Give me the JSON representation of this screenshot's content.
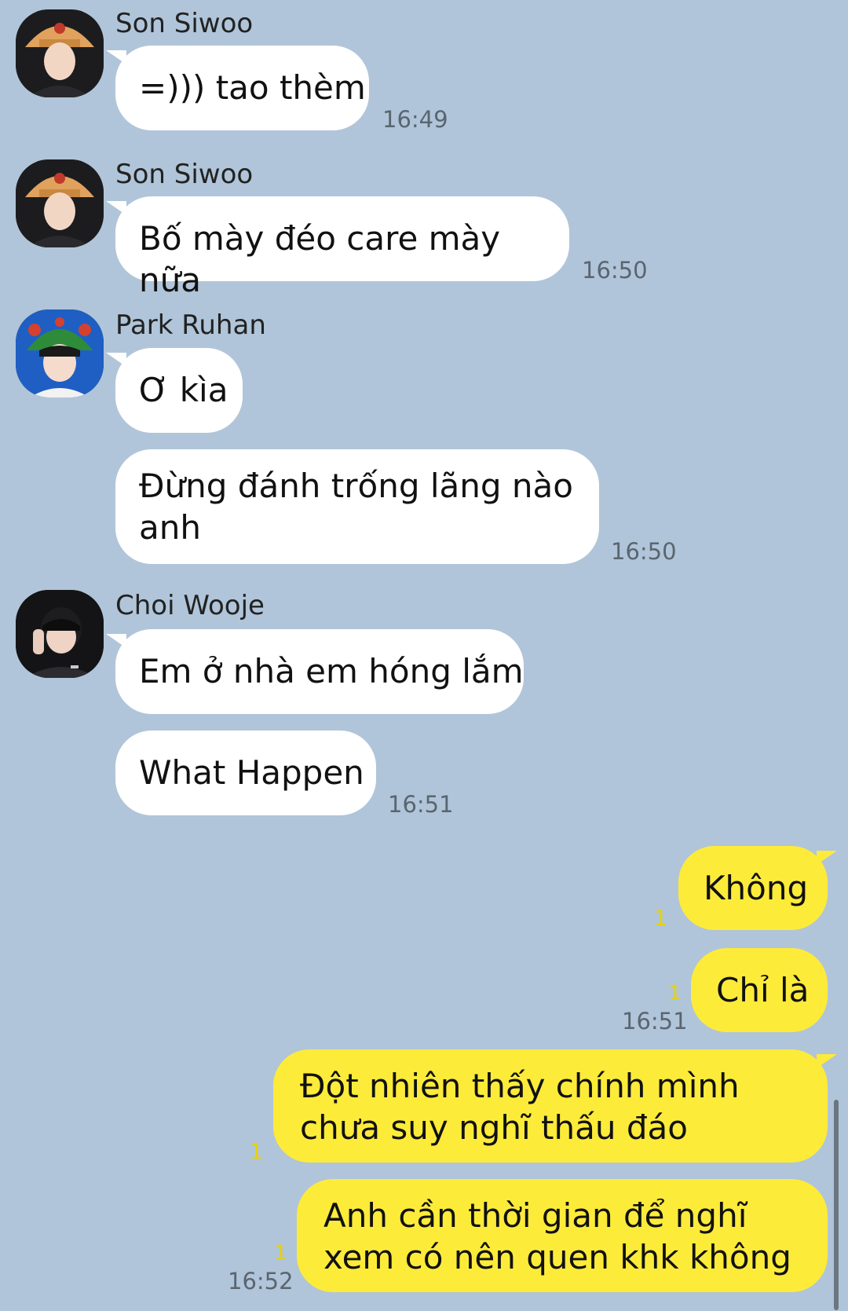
{
  "conversation": [
    {
      "sender": "Son Siwoo",
      "avatar": "son-siwoo-avatar",
      "messages": [
        "=))) tao thèm"
      ],
      "time": "16:49"
    },
    {
      "sender": "Son Siwoo",
      "avatar": "son-siwoo-avatar",
      "messages": [
        "Bố mày đéo care mày nữa"
      ],
      "time": "16:50"
    },
    {
      "sender": "Park Ruhan",
      "avatar": "park-ruhan-avatar",
      "messages": [
        "Ơ kìa",
        "Đừng đánh trống lãng nào anh"
      ],
      "time": "16:50"
    },
    {
      "sender": "Choi Wooje",
      "avatar": "choi-wooje-avatar",
      "messages": [
        "Em ở nhà em hóng lắm",
        "What Happen"
      ],
      "time": "16:51"
    }
  ],
  "my_messages": [
    {
      "text": "Không",
      "unread": "1"
    },
    {
      "text": "Chỉ là",
      "unread": "1",
      "time": "16:51"
    },
    {
      "text": "Đột nhiên thấy chính mình chưa suy nghĩ thấu đáo",
      "unread": "1"
    },
    {
      "text": "Anh cần thời gian để nghĩ xem có nên quen khk không",
      "unread": "1",
      "time": "16:52"
    }
  ],
  "colors": {
    "background": "#b0c5d9",
    "incoming_bubble": "#ffffff",
    "outgoing_bubble": "#fdeb3a",
    "unread": "#e8d100"
  }
}
